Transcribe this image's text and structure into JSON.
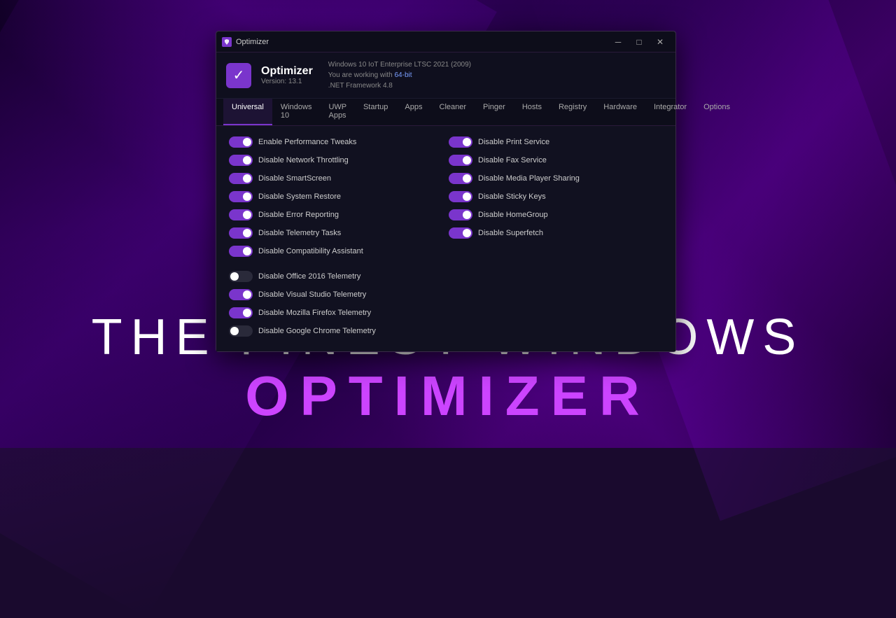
{
  "background": {
    "color": "#1a0a2e"
  },
  "watermark": {
    "line1": "THE FINEST WINDOWS",
    "line2": "OPTIMIZER"
  },
  "window": {
    "titlebar": {
      "title": "Optimizer",
      "minimize_label": "─",
      "maximize_label": "□",
      "close_label": "✕"
    },
    "header": {
      "app_name": "Optimizer",
      "app_version": "Version: 13.1",
      "info_line1": "Windows 10 IoT Enterprise LTSC 2021 (2009)",
      "info_line2": "You are working with 64-bit",
      "info_line3": ".NET Framework 4.8"
    },
    "nav": {
      "tabs": [
        {
          "label": "Universal",
          "active": true
        },
        {
          "label": "Windows 10",
          "active": false
        },
        {
          "label": "UWP Apps",
          "active": false
        },
        {
          "label": "Startup",
          "active": false
        },
        {
          "label": "Apps",
          "active": false
        },
        {
          "label": "Cleaner",
          "active": false
        },
        {
          "label": "Pinger",
          "active": false
        },
        {
          "label": "Hosts",
          "active": false
        },
        {
          "label": "Registry",
          "active": false
        },
        {
          "label": "Hardware",
          "active": false
        },
        {
          "label": "Integrator",
          "active": false
        },
        {
          "label": "Options",
          "active": false
        }
      ]
    },
    "toggles_left": [
      {
        "label": "Enable Performance Tweaks",
        "state": "on"
      },
      {
        "label": "Disable Network Throttling",
        "state": "on"
      },
      {
        "label": "Disable SmartScreen",
        "state": "on"
      },
      {
        "label": "Disable System Restore",
        "state": "on"
      },
      {
        "label": "Disable Error Reporting",
        "state": "on"
      },
      {
        "label": "Disable Telemetry Tasks",
        "state": "on"
      },
      {
        "label": "Disable Compatibility Assistant",
        "state": "on"
      }
    ],
    "toggles_right": [
      {
        "label": "Disable Print Service",
        "state": "on"
      },
      {
        "label": "Disable Fax Service",
        "state": "on"
      },
      {
        "label": "Disable Media Player Sharing",
        "state": "on"
      },
      {
        "label": "Disable Sticky Keys",
        "state": "on"
      },
      {
        "label": "Disable HomeGroup",
        "state": "on"
      },
      {
        "label": "Disable Superfetch",
        "state": "on"
      }
    ],
    "toggles_single": [
      {
        "label": "Disable Office 2016 Telemetry",
        "state": "off"
      },
      {
        "label": "Disable Visual Studio Telemetry",
        "state": "on"
      },
      {
        "label": "Disable Mozilla Firefox Telemetry",
        "state": "on"
      },
      {
        "label": "Disable Google Chrome Telemetry",
        "state": "off"
      }
    ]
  }
}
